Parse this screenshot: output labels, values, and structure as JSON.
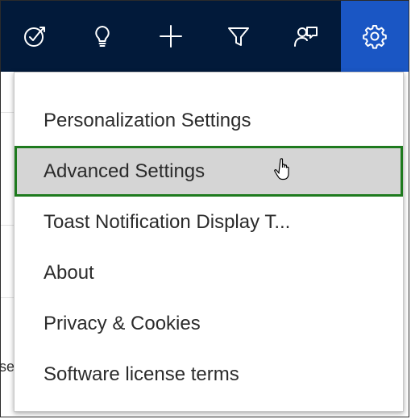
{
  "toolbar": {
    "buttons": [
      {
        "icon": "task-flow-icon",
        "active": false
      },
      {
        "icon": "lightbulb-icon",
        "active": false
      },
      {
        "icon": "plus-icon",
        "active": false
      },
      {
        "icon": "filter-icon",
        "active": false
      },
      {
        "icon": "assistant-icon",
        "active": false
      },
      {
        "icon": "gear-icon",
        "active": true
      }
    ],
    "background_color": "#021a3a",
    "active_color": "#1a56c4"
  },
  "settings_menu": {
    "items": [
      {
        "label": "Personalization Settings",
        "highlighted": false
      },
      {
        "label": "Advanced Settings",
        "highlighted": true
      },
      {
        "label": "Toast Notification Display T...",
        "highlighted": false
      },
      {
        "label": "About",
        "highlighted": false
      },
      {
        "label": "Privacy & Cookies",
        "highlighted": false
      },
      {
        "label": "Software license terms",
        "highlighted": false
      }
    ],
    "highlight_outline_color": "#1e7a1e"
  },
  "background": {
    "partial_text": "se"
  }
}
